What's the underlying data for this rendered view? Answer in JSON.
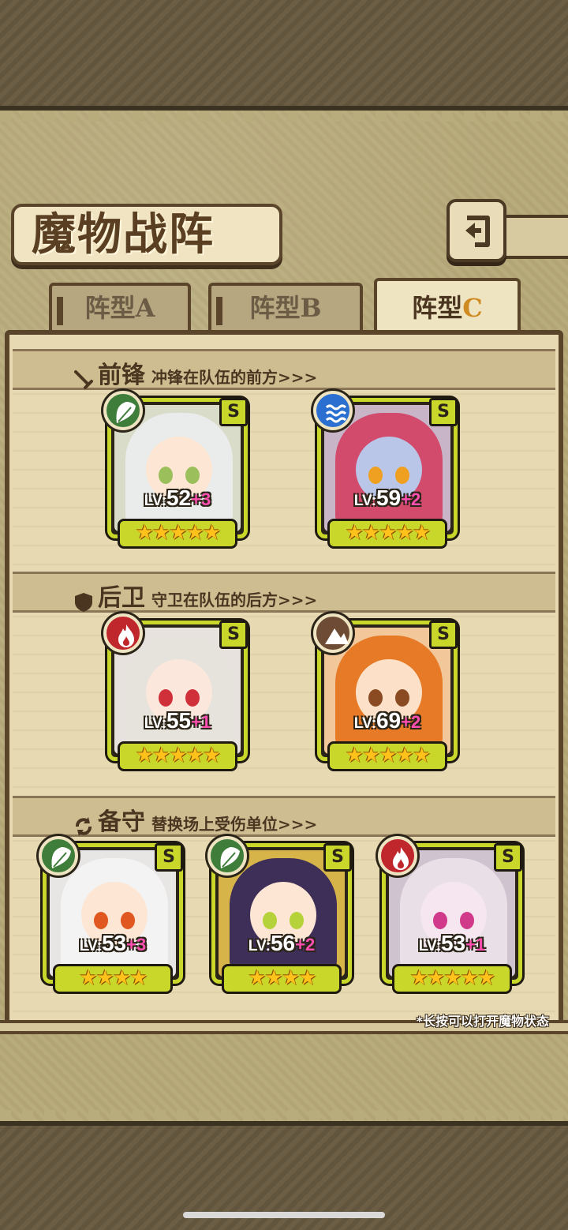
{
  "screen": {
    "title": "魔物战阵",
    "hint": "*长按可以打开魔物状态"
  },
  "tabs": [
    {
      "label": "阵型",
      "suffix": "A",
      "active": false
    },
    {
      "label": "阵型",
      "suffix": "B",
      "active": false
    },
    {
      "label": "阵型",
      "suffix": "C",
      "active": true
    }
  ],
  "sections": {
    "vanguard": {
      "title": "前锋",
      "subtitle": "冲锋在队伍的前方>>>"
    },
    "rearguard": {
      "title": "后卫",
      "subtitle": "守卫在队伍的后方>>>"
    },
    "reserve": {
      "title": "备守",
      "subtitle": "替换场上受伤单位>>>"
    }
  },
  "units": [
    {
      "slot": "vanguard",
      "rank": "S",
      "element": "nature-leaf-icon",
      "element_color": "#3f7d3a",
      "level_label": "LV:",
      "level": "52",
      "plus": "+3",
      "stars": "★★★★★",
      "star_count": 5,
      "hair_color": "#e9ecea",
      "skin": "#fde6d4",
      "eye": "#9bbf5a",
      "bg": "#d9dcc8"
    },
    {
      "slot": "vanguard",
      "rank": "S",
      "element": "water-wave-icon",
      "element_color": "#2b6fd1",
      "level_label": "LV:",
      "level": "59",
      "plus": "+2",
      "stars": "★★★★★",
      "star_count": 5,
      "hair_color": "#d24a6c",
      "skin": "#b9c6e8",
      "eye": "#f0a020",
      "bg": "#c8b5c8"
    },
    {
      "slot": "rearguard",
      "rank": "S",
      "element": "fire-flame-icon",
      "element_color": "#c0272d",
      "level_label": "LV:",
      "level": "55",
      "plus": "+1",
      "stars": "★★★★★",
      "star_count": 5,
      "hair_color": "#e6e2dc",
      "skin": "#fbe7dc",
      "eye": "#d0303a",
      "bg": "#e7e2dd"
    },
    {
      "slot": "rearguard",
      "rank": "S",
      "element": "earth-mountain-icon",
      "element_color": "#6d4b34",
      "level_label": "LV:",
      "level": "69",
      "plus": "+2",
      "stars": "★★★★★",
      "star_count": 5,
      "hair_color": "#e67a26",
      "skin": "#fce1c8",
      "eye": "#8a4a22",
      "bg": "#f2c79a"
    },
    {
      "slot": "reserve",
      "rank": "S",
      "element": "nature-leaf-icon",
      "element_color": "#3f7d3a",
      "level_label": "LV:",
      "level": "53",
      "plus": "+3",
      "stars": "★★★★",
      "star_count": 4,
      "hair_color": "#f4f3f3",
      "skin": "#fde6d4",
      "eye": "#e0571f",
      "bg": "#e8e6e4"
    },
    {
      "slot": "reserve",
      "rank": "S",
      "element": "nature-leaf-icon",
      "element_color": "#3f7d3a",
      "level_label": "LV:",
      "level": "56",
      "plus": "+2",
      "stars": "★★★★",
      "star_count": 4,
      "hair_color": "#3d2f58",
      "skin": "#fde6d4",
      "eye": "#b6d23a",
      "bg": "#d7b44a"
    },
    {
      "slot": "reserve",
      "rank": "S",
      "element": "fire-flame-icon",
      "element_color": "#c0272d",
      "level_label": "LV:",
      "level": "53",
      "plus": "+1",
      "stars": "★★★★★",
      "star_count": 5,
      "hair_color": "#e9dfe6",
      "skin": "#f5e6f0",
      "eye": "#d13a8a",
      "bg": "#cfc3cf"
    }
  ]
}
